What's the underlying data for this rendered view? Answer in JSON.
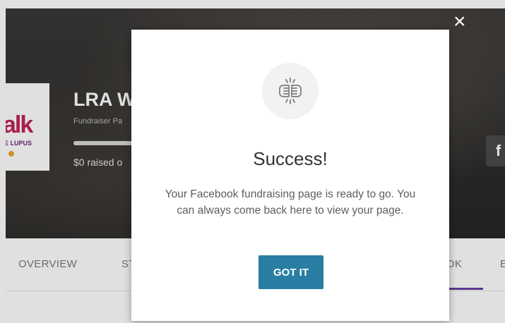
{
  "hero": {
    "title": "LRA W",
    "subtitle": "Fundraiser Pa",
    "raised": "$0 raised o",
    "logo_word": "alk",
    "logo_sub": "E LUPUS",
    "share_icon_label": "f",
    "progress_fraction": 0
  },
  "tabs": [
    {
      "label": "OVERVIEW"
    },
    {
      "label": "ST"
    },
    {
      "label": "OK"
    },
    {
      "label": "E"
    }
  ],
  "modal": {
    "close_label": "×",
    "icon": "fist-bump-icon",
    "title": "Success!",
    "body": "Your Facebook fundraising page is ready to go. You can always come back here to view your page.",
    "button_label": "GOT IT"
  },
  "colors": {
    "button": "#2a7ea3",
    "tab_active_underline": "#6a3fa0",
    "logo_pink": "#c0245c"
  }
}
